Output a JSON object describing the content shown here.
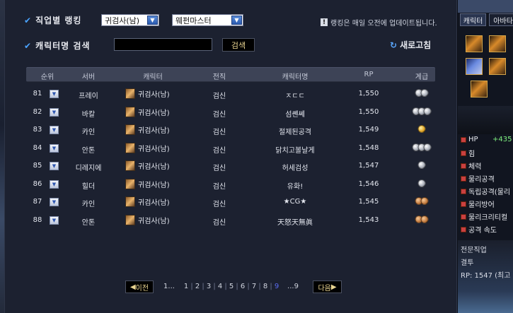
{
  "filters": {
    "job_ranking_label": "직업별 랭킹",
    "class_select": "귀검사(남)",
    "job_select": "웨펀마스터",
    "name_search_label": "캐릭터명 검색",
    "search_button": "검색",
    "notice": "랭킹은 매일 오전에 업데이트됩니다.",
    "refresh_label": "새로고침"
  },
  "table": {
    "headers": [
      "순위",
      "서버",
      "캐릭터",
      "전직",
      "캐릭터명",
      "RP",
      "계급"
    ],
    "rows": [
      {
        "rank": "81",
        "server": "프레이",
        "character": "귀검사(남)",
        "job": "검신",
        "name": "ㅈㄷㄷ",
        "rp": "1,550",
        "grade": [
          "silver",
          "silver"
        ]
      },
      {
        "rank": "82",
        "server": "바칼",
        "character": "귀검사(남)",
        "job": "검신",
        "name": "섬쏀쎄",
        "rp": "1,550",
        "grade": [
          "silver",
          "silver",
          "silver"
        ]
      },
      {
        "rank": "83",
        "server": "카인",
        "character": "귀검사(남)",
        "job": "검신",
        "name": "절제된공격",
        "rp": "1,549",
        "grade": [
          "gold"
        ]
      },
      {
        "rank": "84",
        "server": "안톤",
        "character": "귀검사(남)",
        "job": "검신",
        "name": "닭치고볼날게",
        "rp": "1,548",
        "grade": [
          "silver",
          "silver",
          "silver"
        ]
      },
      {
        "rank": "85",
        "server": "디레지에",
        "character": "귀검사(남)",
        "job": "검신",
        "name": "허세검성",
        "rp": "1,547",
        "grade": [
          "silver"
        ]
      },
      {
        "rank": "86",
        "server": "힐더",
        "character": "귀검사(남)",
        "job": "검신",
        "name": "유화!",
        "rp": "1,546",
        "grade": [
          "silver"
        ]
      },
      {
        "rank": "87",
        "server": "카인",
        "character": "귀검사(남)",
        "job": "검신",
        "name": "★CG★",
        "rp": "1,545",
        "grade": [
          "bronze",
          "bronze"
        ]
      },
      {
        "rank": "88",
        "server": "안톤",
        "character": "귀검사(남)",
        "job": "검신",
        "name": "天怒天無眞",
        "rp": "1,543",
        "grade": [
          "bronze",
          "bronze"
        ]
      }
    ]
  },
  "pagination": {
    "prev": "이전",
    "first": "1...",
    "pages": [
      "1",
      "2",
      "3",
      "4",
      "5",
      "6",
      "7",
      "8",
      "9"
    ],
    "current": "9",
    "last": "...9",
    "next": "다음"
  },
  "side_panel": {
    "tab_character": "캐릭터",
    "tab_avatar": "아바타",
    "hp_label": "HP",
    "hp_value": "+435",
    "stats": [
      "힘",
      "체력",
      "물리공격",
      "독립공격(물리",
      "물리방어",
      "물리크리티컬",
      "공격 속도"
    ],
    "bottom_lines": [
      "전문직업",
      "결투",
      "RP: 1547 (최고"
    ]
  },
  "colors": {
    "accent_check": "#4aa3ff",
    "button_text": "#e8d390",
    "current_page": "#5a6cf0"
  }
}
